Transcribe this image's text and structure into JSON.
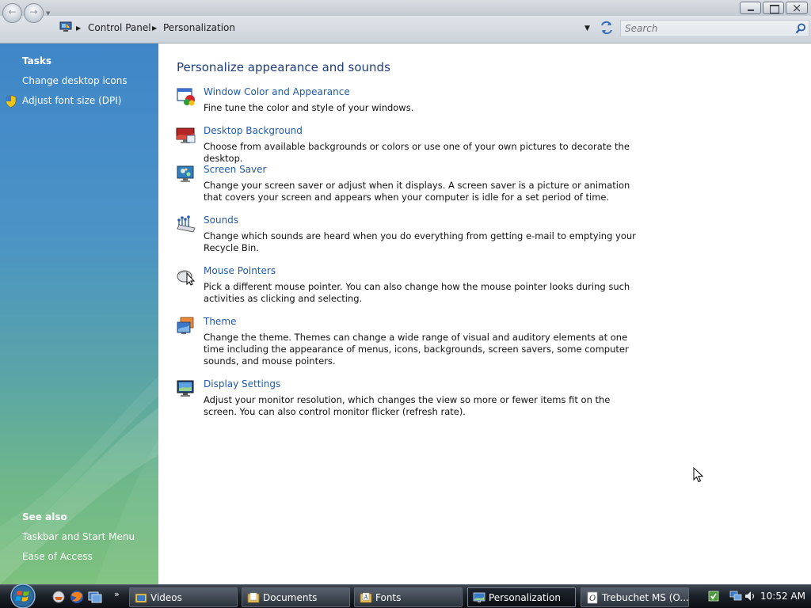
{
  "window": {
    "title_buttons": [
      "minimize",
      "maximize",
      "close"
    ]
  },
  "address_bar": {
    "breadcrumbs": [
      "Control Panel",
      "Personalization"
    ],
    "search_placeholder": "Search"
  },
  "tasks_pane": {
    "heading": "Tasks",
    "links": [
      "Change desktop icons",
      "Adjust font size (DPI)"
    ],
    "see_also_heading": "See also",
    "see_also_links": [
      "Taskbar and Start Menu",
      "Ease of Access"
    ]
  },
  "main": {
    "title": "Personalize appearance and sounds",
    "items": [
      {
        "label": "Window Color and Appearance",
        "description": "Fine tune the color and style of your windows.",
        "icon": "window-color-icon"
      },
      {
        "label": "Desktop Background",
        "description": "Choose from available backgrounds or colors or use one of your own pictures to decorate the desktop.",
        "icon": "desktop-background-icon"
      },
      {
        "label": "Screen Saver",
        "description": "Change your screen saver or adjust when it displays. A screen saver is a picture or animation that covers your screen and appears when your computer is idle for a set period of time.",
        "icon": "screen-saver-icon"
      },
      {
        "label": "Sounds",
        "description": "Change which sounds are heard when you do everything from getting e-mail to emptying your Recycle Bin.",
        "icon": "sounds-icon"
      },
      {
        "label": "Mouse Pointers",
        "description": "Pick a different mouse pointer. You can also change how the mouse pointer looks during such activities as clicking and selecting.",
        "icon": "mouse-pointers-icon"
      },
      {
        "label": "Theme",
        "description": "Change the theme. Themes can change a wide range of visual and auditory elements at one time including the appearance of menus, icons, backgrounds, screen savers, some computer sounds, and mouse pointers.",
        "icon": "theme-icon"
      },
      {
        "label": "Display Settings",
        "description": "Adjust your monitor resolution, which changes the view so more or fewer items fit on the screen. You can also control monitor flicker (refresh rate).",
        "icon": "display-settings-icon"
      }
    ]
  },
  "taskbar": {
    "quick_launch": [
      "show-desktop-icon",
      "firefox-icon",
      "switch-windows-icon"
    ],
    "more_label": "»",
    "tasks": [
      {
        "label": "Videos",
        "active": false
      },
      {
        "label": "Documents",
        "active": false
      },
      {
        "label": "Fonts",
        "active": false
      },
      {
        "label": "Personalization",
        "active": true
      },
      {
        "label": "Trebuchet MS (O...",
        "active": false
      }
    ],
    "clock": "10:52 AM"
  },
  "colors": {
    "link": "#2159a7",
    "title": "#1e3e78",
    "pane_top": "#3f86c8",
    "pane_bottom": "#7dc17d"
  }
}
